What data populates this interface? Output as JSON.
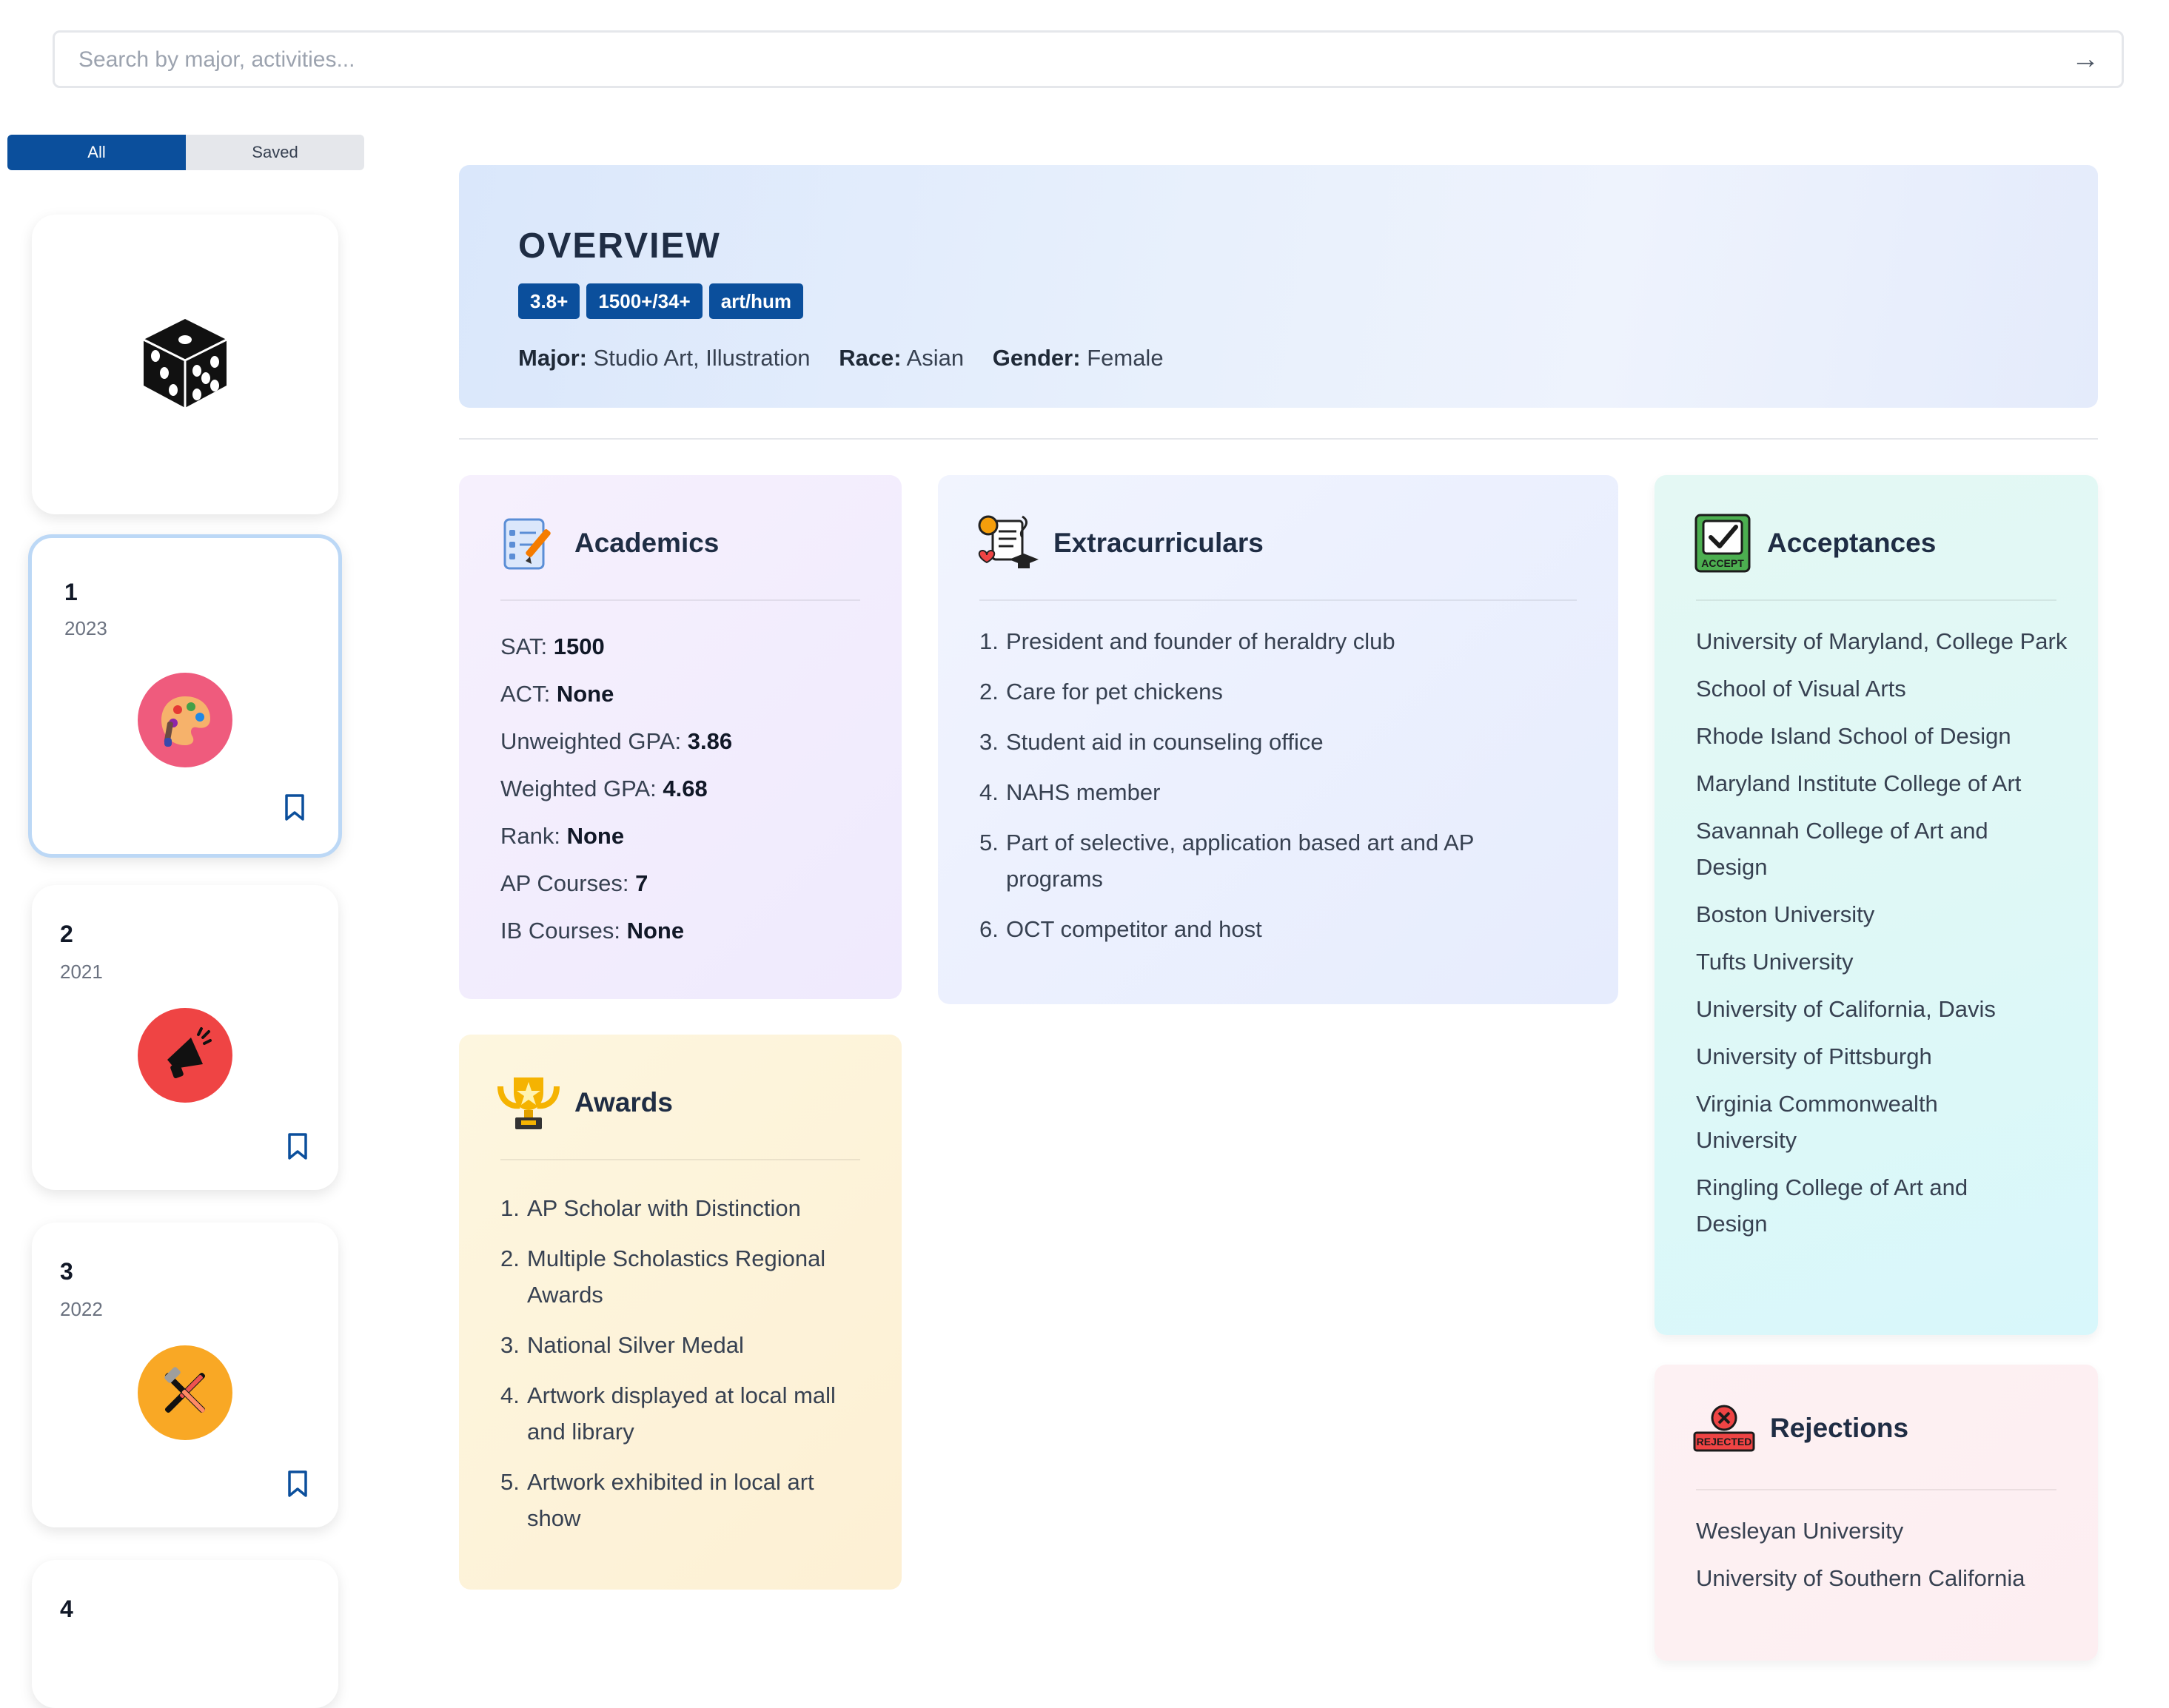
{
  "search": {
    "placeholder": "Search by major, activities...",
    "submit_icon": "arrow-right-icon"
  },
  "filter_tabs": {
    "all": "All",
    "saved": "Saved"
  },
  "sidebar": {
    "hero_icon": "dice-icon",
    "cards": [
      {
        "number": "1",
        "year": "2023",
        "icon": "art-palette-icon",
        "icon_color": "#ef5b7d"
      },
      {
        "number": "2",
        "year": "2021",
        "icon": "megaphone-icon",
        "icon_color": "#ef4444"
      },
      {
        "number": "3",
        "year": "2022",
        "icon": "tools-icon",
        "icon_color": "#f9a825"
      },
      {
        "number": "4"
      }
    ]
  },
  "overview": {
    "title": "OVERVIEW",
    "badges": [
      "3.8+",
      "1500+/34+",
      "art/hum"
    ],
    "major_label": "Major:",
    "major": "Studio Art, Illustration",
    "race_label": "Race:",
    "race": "Asian",
    "gender_label": "Gender:",
    "gender": "Female"
  },
  "academics": {
    "title": "Academics",
    "icon": "checklist-icon",
    "rows": [
      {
        "label": "SAT:",
        "value": "1500"
      },
      {
        "label": "ACT:",
        "value": "None"
      },
      {
        "label": "Unweighted GPA:",
        "value": "3.86"
      },
      {
        "label": "Weighted GPA:",
        "value": "4.68"
      },
      {
        "label": "Rank:",
        "value": "None"
      },
      {
        "label": "AP Courses:",
        "value": "7"
      },
      {
        "label": "IB Courses:",
        "value": "None"
      }
    ]
  },
  "extracurriculars": {
    "title": "Extracurriculars",
    "icon": "activities-icon",
    "items": [
      "President and founder of heraldry club",
      "Care for pet chickens",
      "Student aid in counseling office",
      "NAHS member",
      "Part of selective, application based art and AP programs",
      "OCT competitor and host"
    ]
  },
  "acceptances": {
    "title": "Acceptances",
    "icon": "accept-stamp-icon",
    "icon_text": "ACCEPT",
    "items": [
      "University of Maryland, College Park",
      "School of Visual Arts",
      "Rhode Island School of Design",
      "Maryland Institute College of Art",
      "Savannah College of Art and Design",
      "Boston University",
      "Tufts University",
      "University of California, Davis",
      "University of Pittsburgh",
      "Virginia Commonwealth University",
      "Ringling College of Art and Design"
    ]
  },
  "awards": {
    "title": "Awards",
    "icon": "trophy-icon",
    "items": [
      "AP Scholar with Distinction",
      "Multiple Scholastics Regional Awards",
      "National Silver Medal",
      "Artwork displayed at local mall and library",
      "Artwork exhibited in local art show"
    ]
  },
  "rejections": {
    "title": "Rejections",
    "icon": "reject-stamp-icon",
    "icon_text": "REJECTED",
    "items": [
      "Wesleyan University",
      "University of Southern California"
    ]
  },
  "colors": {
    "accent": "#0b4f9c",
    "selected_border": "#bcd8f6"
  }
}
